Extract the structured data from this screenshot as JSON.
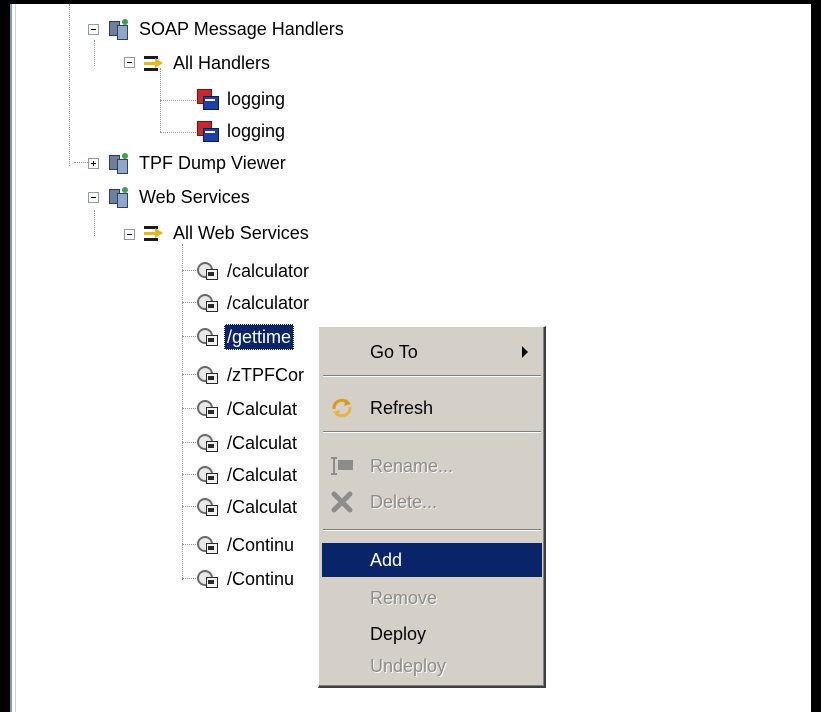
{
  "tree": {
    "items": [
      {
        "label": "SOAP Message Handlers",
        "icon": "server-group-icon"
      },
      {
        "label": "All Handlers",
        "icon": "handlers-arrows-icon"
      },
      {
        "label": "logging",
        "icon": "handler-logging-icon"
      },
      {
        "label": "logging",
        "icon": "handler-logging-icon"
      },
      {
        "label": "TPF Dump Viewer",
        "icon": "server-group-icon"
      },
      {
        "label": "Web Services",
        "icon": "server-group-icon"
      },
      {
        "label": "All Web Services",
        "icon": "handlers-arrows-icon"
      },
      {
        "label": "/calculator",
        "icon": "web-service-icon"
      },
      {
        "label": "/calculator",
        "icon": "web-service-icon"
      },
      {
        "label": "/gettime",
        "icon": "web-service-icon",
        "selected": true
      },
      {
        "label": "/zTPFCor",
        "icon": "web-service-icon"
      },
      {
        "label": "/Calculat",
        "icon": "web-service-icon"
      },
      {
        "label": "/Calculat",
        "icon": "web-service-icon"
      },
      {
        "label": "/Calculat",
        "icon": "web-service-icon"
      },
      {
        "label": "/Calculat",
        "icon": "web-service-icon"
      },
      {
        "label": "/Continu",
        "icon": "web-service-icon"
      },
      {
        "label": "/Continu",
        "icon": "web-service-icon"
      }
    ]
  },
  "menu": {
    "goto": "Go To",
    "refresh": "Refresh",
    "rename": "Rename...",
    "delete": "Delete...",
    "add": "Add",
    "remove": "Remove",
    "deploy": "Deploy",
    "undeploy": "Undeploy"
  },
  "colors": {
    "selection": "#0a246a",
    "menu_bg": "#d4d0c8",
    "disabled_text": "#8c8c8c"
  }
}
